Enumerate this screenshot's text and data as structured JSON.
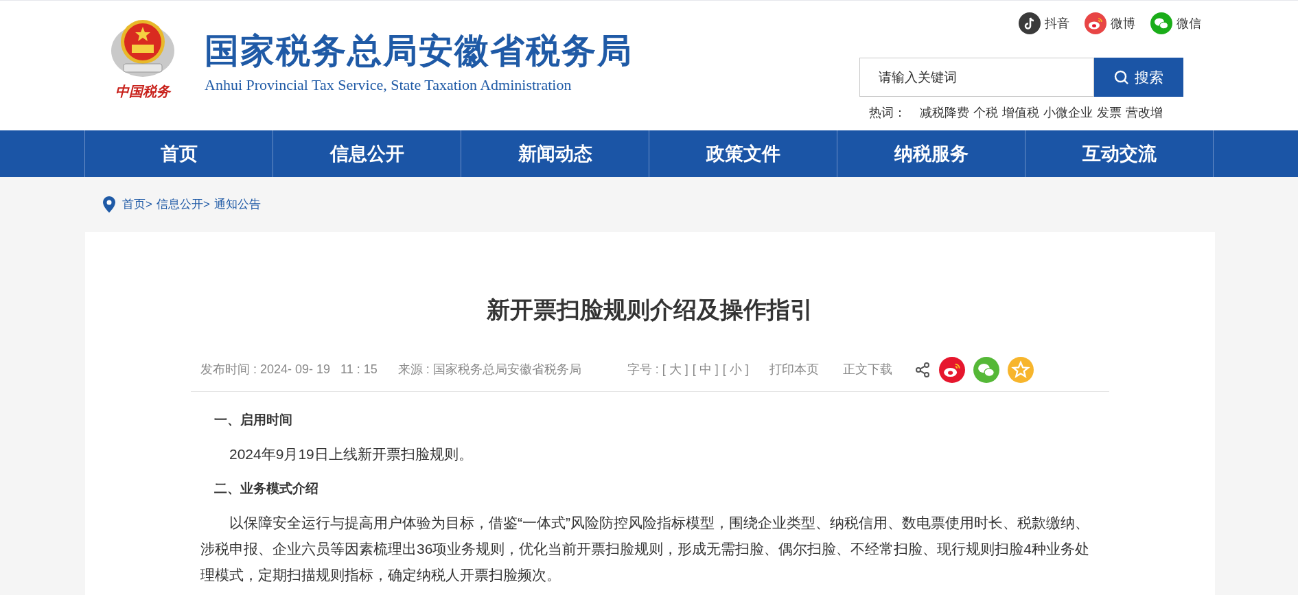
{
  "header": {
    "logo_caption": "中国税务",
    "title": "国家税务总局安徽省税务局",
    "subtitle": "Anhui Provincial Tax Service, State Taxation Administration",
    "social": [
      {
        "kind": "douyin",
        "label": "抖音"
      },
      {
        "kind": "weibo",
        "label": "微博"
      },
      {
        "kind": "wechat",
        "label": "微信"
      }
    ],
    "search": {
      "placeholder": "请输入关键词",
      "button": "搜索"
    },
    "hot_label": "热词：",
    "hot_words": [
      "减税降费",
      "个税",
      "增值税",
      "小微企业",
      "发票",
      "营改增"
    ]
  },
  "nav": [
    {
      "label": "首页"
    },
    {
      "label": "信息公开"
    },
    {
      "label": "新闻动态"
    },
    {
      "label": "政策文件"
    },
    {
      "label": "纳税服务"
    },
    {
      "label": "互动交流"
    }
  ],
  "breadcrumb": [
    "首页>",
    "信息公开>",
    "通知公告"
  ],
  "article": {
    "title": "新开票扫脸规则介绍及操作指引",
    "meta": {
      "published": "发布时间 : 2024- 09- 19   11 : 15",
      "source": "来源 : 国家税务总局安徽省税务局",
      "font_size_label": "字号 : ",
      "font_sizes": [
        "[ 大 ]",
        "[ 中 ]",
        "[ 小 ]"
      ],
      "print": "打印本页",
      "download": "正文下载"
    },
    "share": [
      {
        "kind": "weibo"
      },
      {
        "kind": "wechat"
      },
      {
        "kind": "favorite"
      }
    ],
    "body": [
      {
        "kind": "heading",
        "text": "一、启用时间"
      },
      {
        "kind": "paragraph",
        "text": "2024年9月19日上线新开票扫脸规则。"
      },
      {
        "kind": "heading",
        "text": "二、业务模式介绍"
      },
      {
        "kind": "paragraph",
        "text": "以保障安全运行与提高用户体验为目标，借鉴“一体式”风险防控风险指标模型，围绕企业类型、纳税信用、数电票使用时长、税款缴纳、涉税申报、企业六员等因素梳理出36项业务规则，优化当前开票扫脸规则，形成无需扫脸、偶尔扫脸、不经常扫脸、现行规则扫脸4种业务处理模式，定期扫描规则指标，确定纳税人开票扫脸频次。"
      }
    ]
  }
}
